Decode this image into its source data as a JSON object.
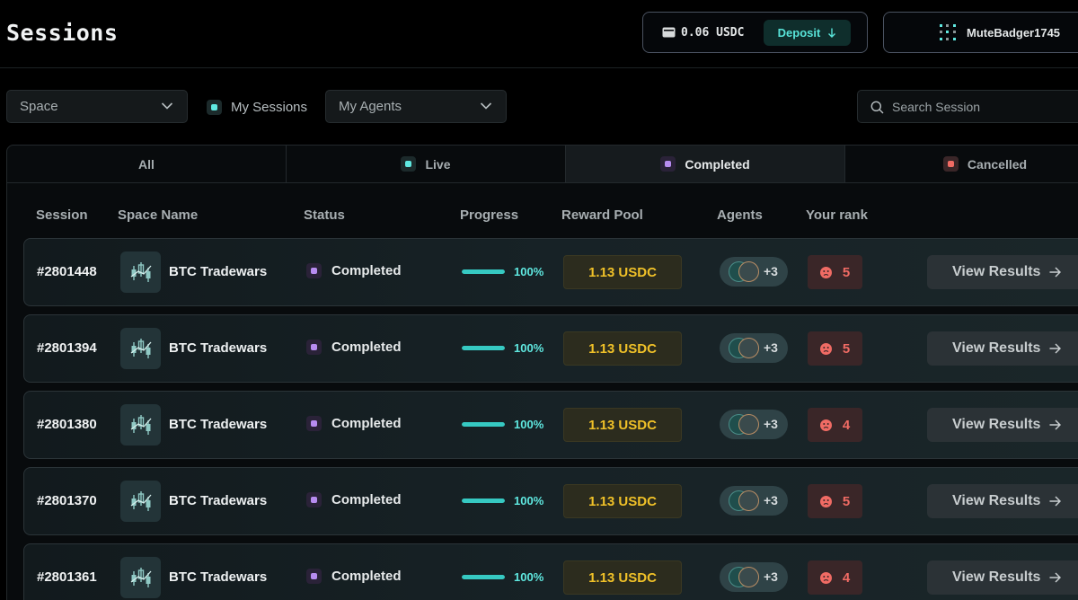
{
  "header": {
    "title": "Sessions",
    "wallet": {
      "balance": "0.06 USDC",
      "deposit_label": "Deposit"
    },
    "user": {
      "name": "MuteBadger1745"
    }
  },
  "filters": {
    "space": {
      "label": "Space"
    },
    "my_sessions": {
      "label": "My Sessions",
      "checked": true
    },
    "agents": {
      "label": "My Agents"
    },
    "search": {
      "placeholder": "Search Session"
    }
  },
  "tabs": [
    {
      "label": "All",
      "dot_color": "",
      "active": false
    },
    {
      "label": "Live",
      "dot_color": "#5fe8e0",
      "active": false
    },
    {
      "label": "Completed",
      "dot_color": "#b78cf0",
      "active": true
    },
    {
      "label": "Cancelled",
      "dot_color": "#f06b64",
      "active": false
    }
  ],
  "table": {
    "columns": [
      "Session",
      "Space Name",
      "Status",
      "Progress",
      "Reward Pool",
      "Agents",
      "Your rank"
    ],
    "rows": [
      {
        "session": "#2801448",
        "space": "BTC Tradewars",
        "status": "Completed",
        "progress": 100,
        "progress_text": "100%",
        "reward": "1.13 USDC",
        "agents_more": "+3",
        "rank": "5",
        "action": "View Results"
      },
      {
        "session": "#2801394",
        "space": "BTC Tradewars",
        "status": "Completed",
        "progress": 100,
        "progress_text": "100%",
        "reward": "1.13 USDC",
        "agents_more": "+3",
        "rank": "5",
        "action": "View Results"
      },
      {
        "session": "#2801380",
        "space": "BTC Tradewars",
        "status": "Completed",
        "progress": 100,
        "progress_text": "100%",
        "reward": "1.13 USDC",
        "agents_more": "+3",
        "rank": "4",
        "action": "View Results"
      },
      {
        "session": "#2801370",
        "space": "BTC Tradewars",
        "status": "Completed",
        "progress": 100,
        "progress_text": "100%",
        "reward": "1.13 USDC",
        "agents_more": "+3",
        "rank": "5",
        "action": "View Results"
      },
      {
        "session": "#2801361",
        "space": "BTC Tradewars",
        "status": "Completed",
        "progress": 100,
        "progress_text": "100%",
        "reward": "1.13 USDC",
        "agents_more": "+3",
        "rank": "4",
        "action": "View Results"
      }
    ]
  },
  "icons": {
    "wallet": "wallet-icon",
    "deposit": "arrow-down-icon",
    "avatar": "pixel-avatar-icon",
    "chevron": "chevron-down-icon",
    "search": "search-icon",
    "space": "candlestick-chart-icon",
    "rank": "sad-face-icon",
    "action": "arrow-right-icon"
  },
  "colors": {
    "accent_cyan": "#5fe8e0",
    "completed_purple": "#b78cf0",
    "cancelled_red": "#f06b64",
    "reward_gold": "#f0c128"
  }
}
